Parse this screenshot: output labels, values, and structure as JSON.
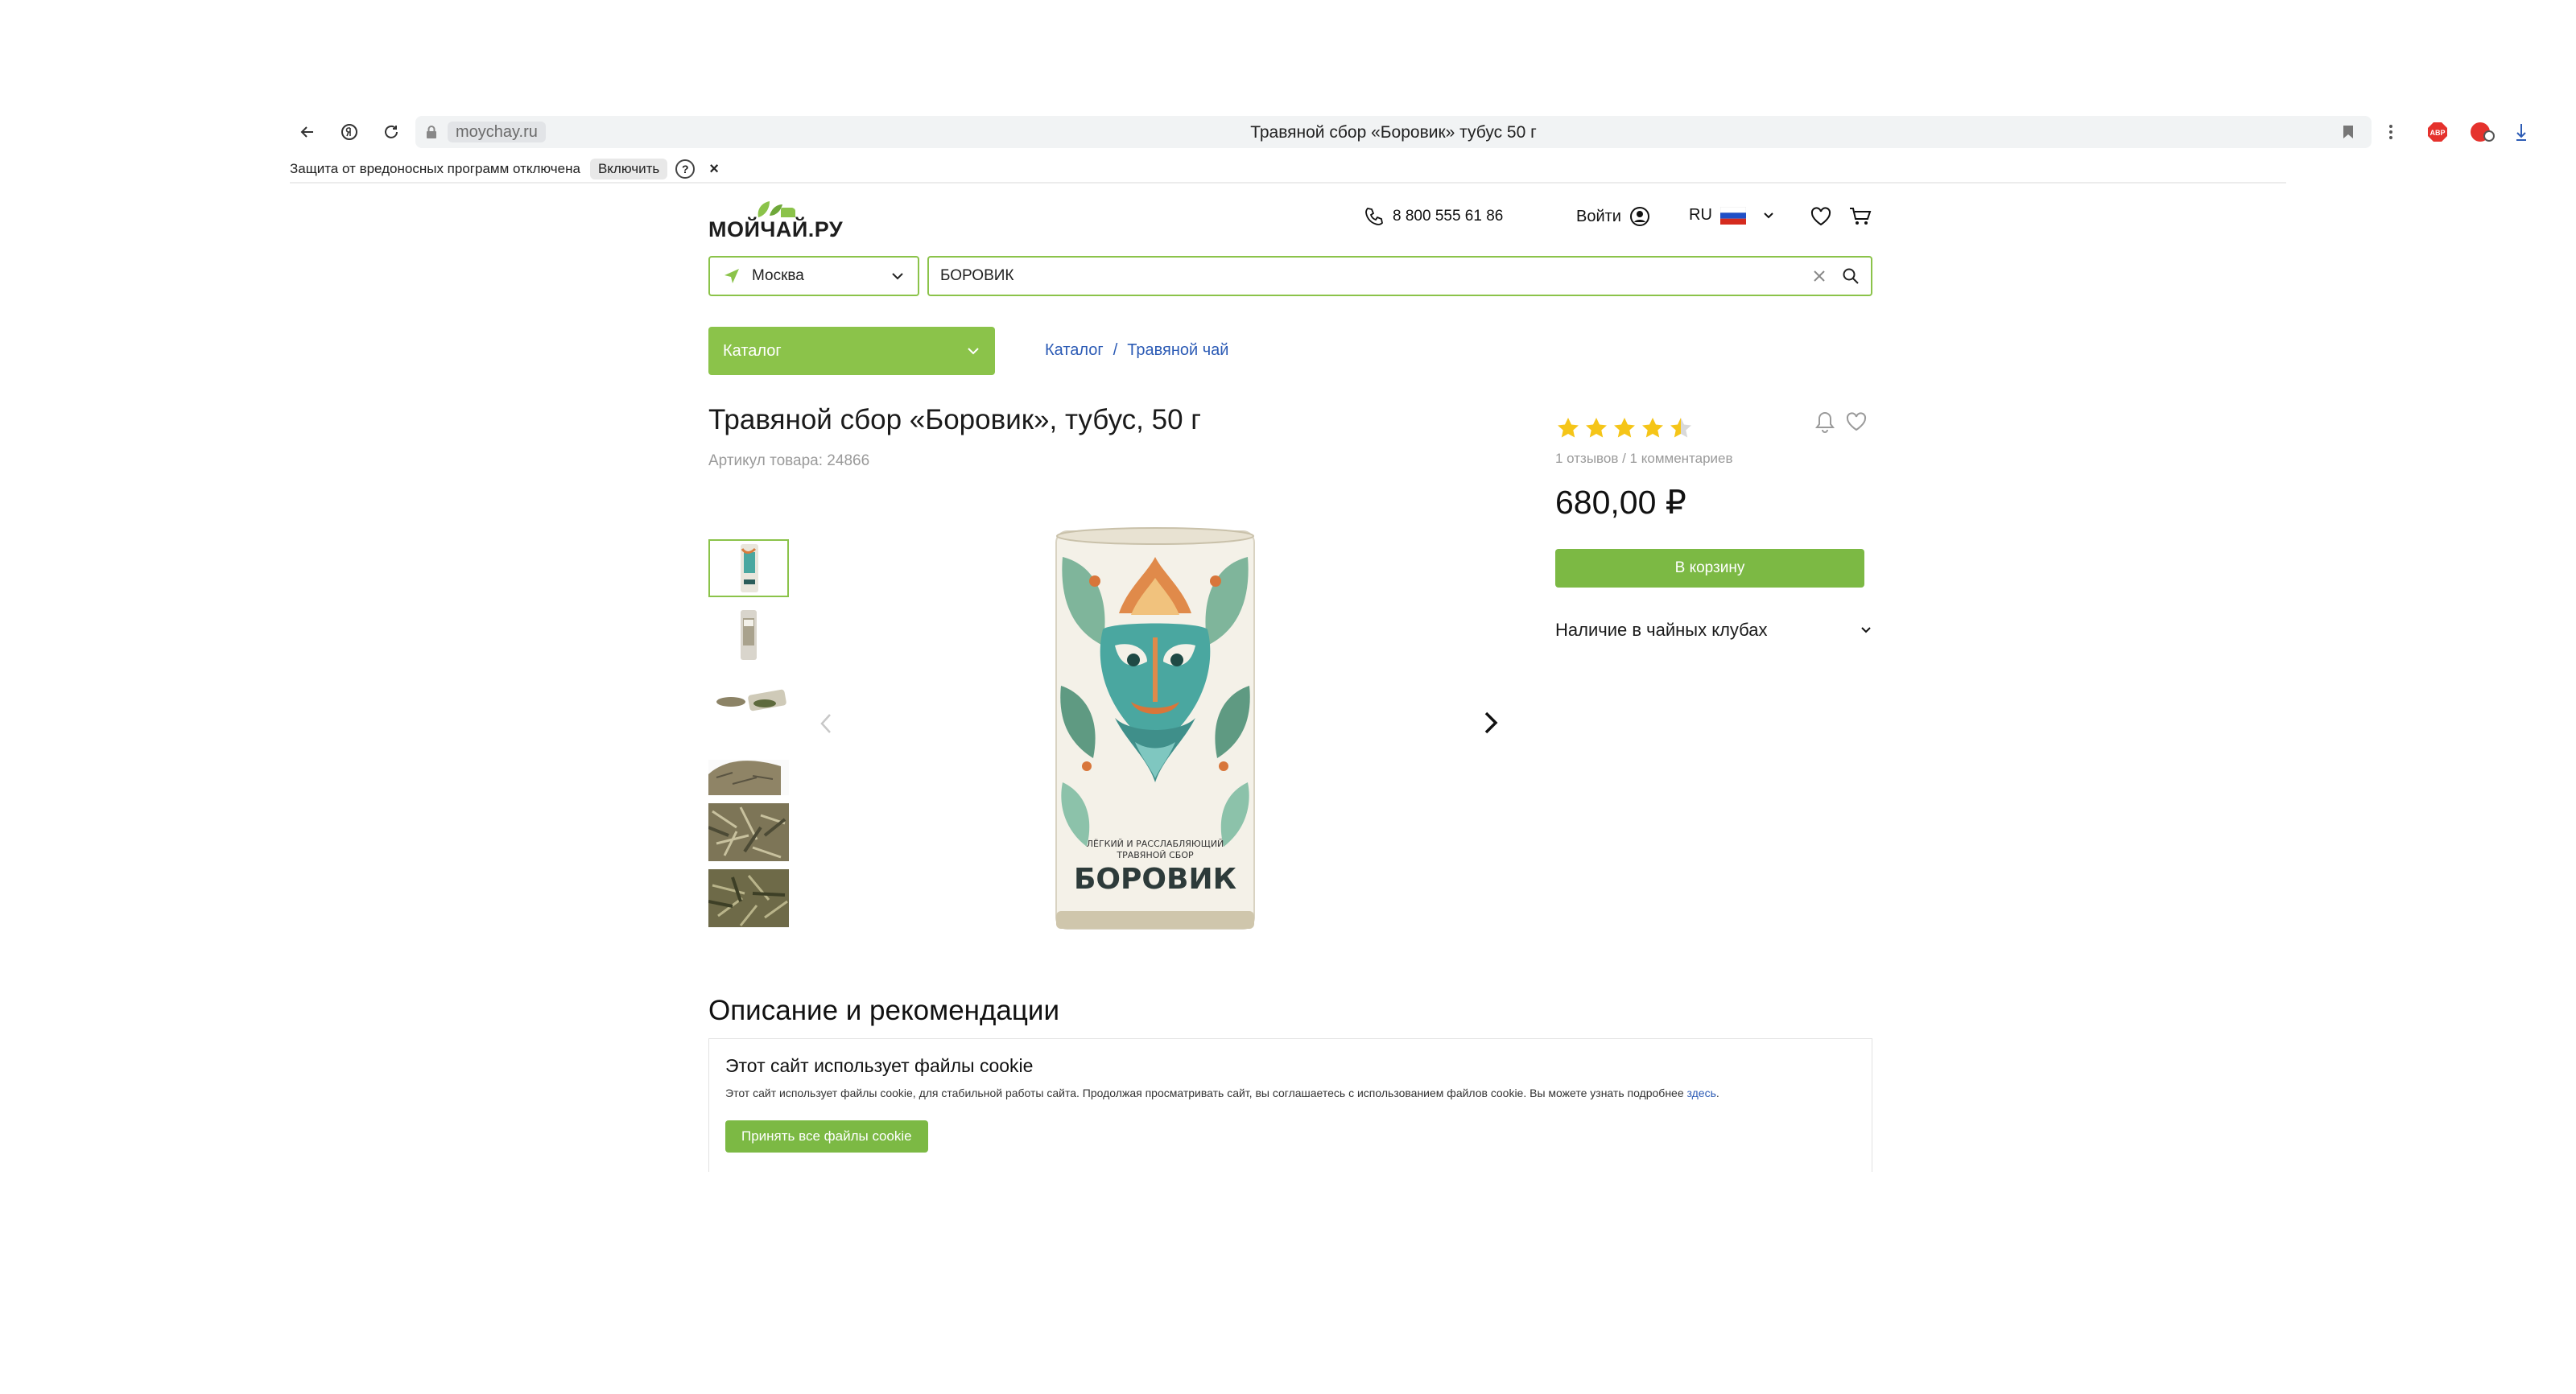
{
  "browser": {
    "domain": "moychay.ru",
    "tab_title": "Травяной сбор «Боровик» тубус 50 г",
    "protection_text": "Защита от вредоносных программ отключена",
    "enable_label": "Включить",
    "help_glyph": "?",
    "close_glyph": "×",
    "ext_abp": "ABP"
  },
  "header": {
    "logo_text": "МОЙЧАЙ.РУ",
    "phone": "8 800 555 61 86",
    "login_label": "Войти",
    "lang": "RU"
  },
  "search": {
    "city": "Москва",
    "query": "БОРОВИК"
  },
  "nav": {
    "catalog_label": "Каталог",
    "breadcrumb": [
      {
        "label": "Каталог"
      },
      {
        "label": "Травяной чай"
      }
    ],
    "breadcrumb_separator": "/"
  },
  "product": {
    "title": "Травяной сбор «Боровик», тубус, 50 г",
    "sku": "Артикул товара: 24866",
    "rating": 4.5,
    "rating_meta": "1 отзывов / 1 комментариев",
    "price": "680,00 ₽",
    "cart_label": "В корзину",
    "availability_label": "Наличие в чайных клубах",
    "package_line1": "ЛЁГКИЙ И РАССЛАБЛЯЮЩИЙ",
    "package_line2": "ТРАВЯНОЙ СБОР",
    "package_name": "БОРОВИК"
  },
  "description": {
    "title": "Описание и рекомендации"
  },
  "cookie": {
    "title": "Этот сайт использует файлы cookie",
    "text": "Этот сайт использует файлы cookie, для стабильной работы сайта. Продолжая просматривать сайт, вы соглашаетесь с использованием файлов cookie. Вы можете узнать подробнее ",
    "link": "здесь",
    "text_end": ".",
    "accept_label": "Принять все файлы cookie"
  },
  "colors": {
    "brand_green": "#8bc34a",
    "button_green": "#7cb944",
    "link_blue": "#2c5bb5",
    "star_yellow": "#f5c518"
  }
}
